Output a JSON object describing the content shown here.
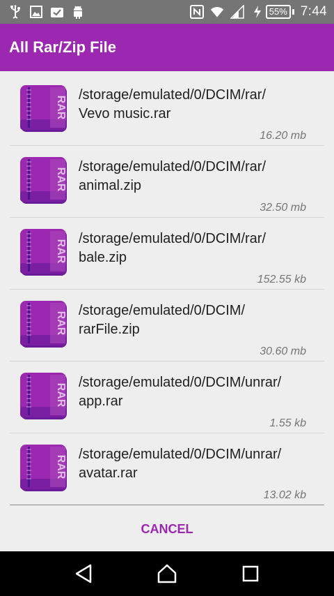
{
  "status_bar": {
    "left_icons": [
      "usb-icon",
      "image-icon",
      "clipboard-check-icon",
      "android-icon"
    ],
    "right_icons": [
      "nfc-icon",
      "wifi-icon",
      "signal-icon",
      "charging-icon"
    ],
    "battery": "55%",
    "time": "7:44"
  },
  "app_bar": {
    "title": "All Rar/Zip File"
  },
  "files": [
    {
      "path": "/storage/emulated/0/DCIM/rar/\nVevo music.rar",
      "size": "16.20 mb",
      "icon": "rar-archive-icon"
    },
    {
      "path": "/storage/emulated/0/DCIM/rar/\nanimal.zip",
      "size": "32.50 mb",
      "icon": "rar-archive-icon"
    },
    {
      "path": "/storage/emulated/0/DCIM/rar/\nbale.zip",
      "size": "152.55 kb",
      "icon": "rar-archive-icon"
    },
    {
      "path": "/storage/emulated/0/DCIM/\nrarFile.zip",
      "size": "30.60 mb",
      "icon": "rar-archive-icon"
    },
    {
      "path": "/storage/emulated/0/DCIM/unrar/\napp.rar",
      "size": "1.55 kb",
      "icon": "rar-archive-icon"
    },
    {
      "path": "/storage/emulated/0/DCIM/unrar/\navatar.rar",
      "size": "13.02 kb",
      "icon": "rar-archive-icon"
    }
  ],
  "dialog": {
    "cancel_label": "CANCEL"
  },
  "nav_bar": {
    "buttons": [
      "back-icon",
      "home-icon",
      "recents-icon"
    ]
  },
  "colors": {
    "accent": "#9c27b0",
    "status_bar": "#757575",
    "background": "#eeeeee"
  }
}
